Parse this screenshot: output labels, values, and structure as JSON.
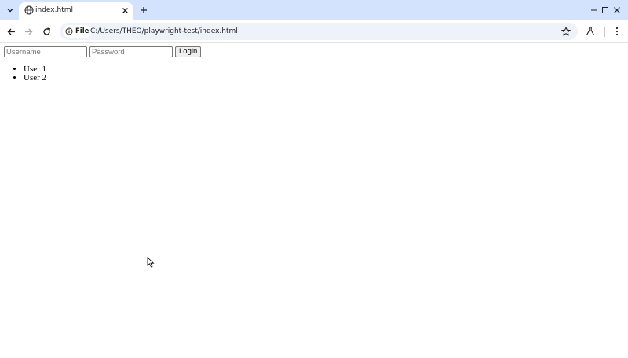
{
  "browser": {
    "tab": {
      "title": "index.html"
    },
    "address_bar": {
      "site_chip_label": "File",
      "url": "C:/Users/THEO/playwright-test/index.html"
    },
    "icons": {
      "tab_search": "chevron-down-icon",
      "favicon": "globe-icon",
      "tab_close": "close-icon",
      "new_tab": "plus-icon",
      "back": "arrow-left-icon",
      "forward": "arrow-right-icon",
      "reload": "reload-icon",
      "info": "info-icon",
      "bookmark": "star-icon",
      "labs": "flask-icon",
      "menu": "kebab-menu-icon",
      "minimize": "minimize-icon",
      "maximize": "maximize-icon",
      "close_window": "close-icon"
    },
    "colors": {
      "tabstrip_bg": "#d3e3fd",
      "omnibox_bg": "#eef2f9"
    }
  },
  "page": {
    "login_form": {
      "username_placeholder": "Username",
      "username_value": "",
      "password_placeholder": "Password",
      "password_value": "",
      "login_label": "Login"
    },
    "users": [
      "User 1",
      "User 2"
    ]
  }
}
